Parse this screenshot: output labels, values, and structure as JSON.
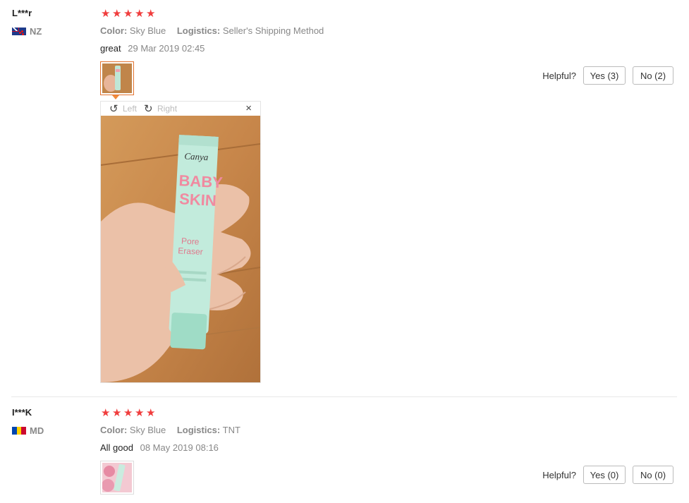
{
  "reviews": [
    {
      "user": "L***r",
      "country": "NZ",
      "rating": 5,
      "color_label": "Color:",
      "color_value": "Sky Blue",
      "logistics_label": "Logistics:",
      "logistics_value": "Seller's Shipping Method",
      "text": "great",
      "date": "29 Mar 2019 02:45",
      "helpful_label": "Helpful?",
      "yes_label": "Yes (3)",
      "no_label": "No (2)",
      "viewer": {
        "left_label": "Left",
        "right_label": "Right",
        "close": "×",
        "rotate_left_icon": "rotate-left-icon",
        "rotate_right_icon": "rotate-right-icon"
      },
      "product_label": {
        "brand": "Canya",
        "line1": "BABY",
        "line2": "SKIN",
        "line3": "Pore",
        "line4": "Eraser"
      }
    },
    {
      "user": "I***K",
      "country": "MD",
      "rating": 5,
      "color_label": "Color:",
      "color_value": "Sky Blue",
      "logistics_label": "Logistics:",
      "logistics_value": "TNT",
      "text": "All good",
      "date": "08 May 2019 08:16",
      "helpful_label": "Helpful?",
      "yes_label": "Yes (0)",
      "no_label": "No (0)"
    }
  ],
  "colors": {
    "star": "#f03d3d",
    "accent": "#e3732f"
  }
}
